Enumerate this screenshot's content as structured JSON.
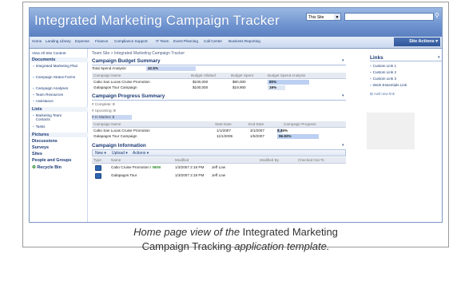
{
  "banner": {
    "title": "Integrated Marketing Campaign Tracker",
    "scope_value": "This Site",
    "search_placeholder": ""
  },
  "topnav": {
    "items": [
      "Home",
      "Landing Library",
      "Expense",
      "Finance",
      "Compliance Support",
      "IT Team",
      "Event Planning",
      "Call Center",
      "Business Reporting"
    ],
    "site_actions": "Site Actions"
  },
  "leftnav": {
    "view_all": "View All Site Content",
    "groups": [
      {
        "heading": "Documents",
        "items": [
          "Integrated Marketing Plan",
          "Campaign Status Forms",
          "Campaign Analyses",
          "Team Resources",
          "Assistance"
        ]
      },
      {
        "heading": "Lists",
        "items": [
          "Marketing Team Contacts",
          "Tasks"
        ]
      },
      {
        "heading": "Pictures",
        "items": []
      },
      {
        "heading": "Discussions",
        "items": []
      },
      {
        "heading": "Surveys",
        "items": []
      },
      {
        "heading": "Sites",
        "items": []
      },
      {
        "heading": "People and Groups",
        "items": []
      }
    ],
    "recycle_bin": "Recycle Bin"
  },
  "breadcrumb": "Team Site > Integrated Marketing Campaign Tracker",
  "budget": {
    "title": "Campaign Budget Summary",
    "total_label": "Total Spend Analysis:",
    "total_value": "42.5%",
    "columns": [
      "Campaign Name",
      "Budget Allotted",
      "Budget Spent",
      "Budget Spend Analysis"
    ],
    "rows": [
      {
        "name": "Cabo San Lucas Cruise Promotion",
        "allotted": "$100,000",
        "spent": "$80,000",
        "analysis": "80%"
      },
      {
        "name": "Galapagos Tour Campaign",
        "allotted": "$100,000",
        "spent": "$19,900",
        "analysis": "19%"
      }
    ]
  },
  "progress": {
    "title": "Campaign Progress Summary",
    "stats": [
      {
        "label": "# Complete:",
        "value": "0"
      },
      {
        "label": "# Upcoming:",
        "value": "0"
      },
      {
        "label": "# In Market:",
        "value": "2"
      }
    ],
    "columns": [
      "Campaign Name",
      "Start Date",
      "End Date",
      "Campaign Progress"
    ],
    "rows": [
      {
        "name": "Cabo San Lucas Cruise Promotion",
        "start": "1/1/2007",
        "end": "3/1/2007",
        "progress": "8.45%"
      },
      {
        "name": "Galapagos Tour Campaign",
        "start": "11/1/2006",
        "end": "1/5/2007",
        "progress": "96.92%"
      }
    ]
  },
  "info": {
    "title": "Campaign Information",
    "toolbar": [
      "New",
      "Upload",
      "Actions"
    ],
    "columns": [
      "Type",
      "Name",
      "Modified",
      "Modified By",
      "Checked Out To"
    ],
    "rows": [
      {
        "name": "Cabo Cruise Promotion",
        "flag": "! NEW",
        "modified": "1/3/2007 2:18 PM",
        "by": "Jeff Low"
      },
      {
        "name": "Galapagos Tour",
        "modified": "1/3/2007 2:18 PM",
        "by": "Jeff Low"
      }
    ]
  },
  "links": {
    "title": "Links",
    "items": [
      "Custom Link 1",
      "Custom Link 2",
      "Custom Link 3",
      "Work Essentials Link"
    ],
    "add_new": "Add new link"
  },
  "caption": {
    "line1_prefix": "Home page view of the",
    "line1_name": "Integrated Marketing",
    "line2_name": "Campaign Tracking",
    "line2_suffix": "application template."
  },
  "colors": {
    "banner": "#6e93cf",
    "accent": "#1b3a75",
    "highlight": "#c9d7f2"
  }
}
